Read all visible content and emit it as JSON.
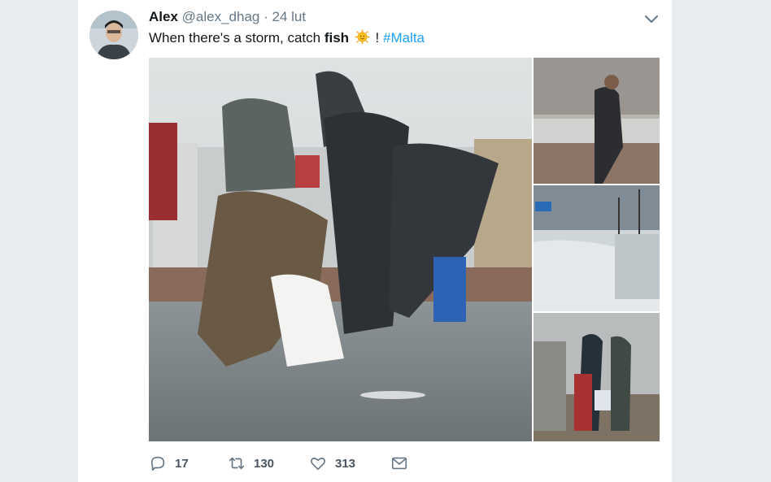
{
  "tweet": {
    "display_name": "Alex",
    "handle": "@alex_dhag",
    "separator": "·",
    "date": "24 lut",
    "text_before": "When there's a storm, catch ",
    "text_bold": "fish",
    "text_after": " ! ",
    "hashtag": "#Malta",
    "emoji": "sun-face-icon"
  },
  "actions": {
    "reply_count": "17",
    "retweet_count": "130",
    "like_count": "313"
  },
  "colors": {
    "background": "#e6ecf0",
    "card": "#ffffff",
    "link": "#1da1f2",
    "muted": "#657786"
  }
}
